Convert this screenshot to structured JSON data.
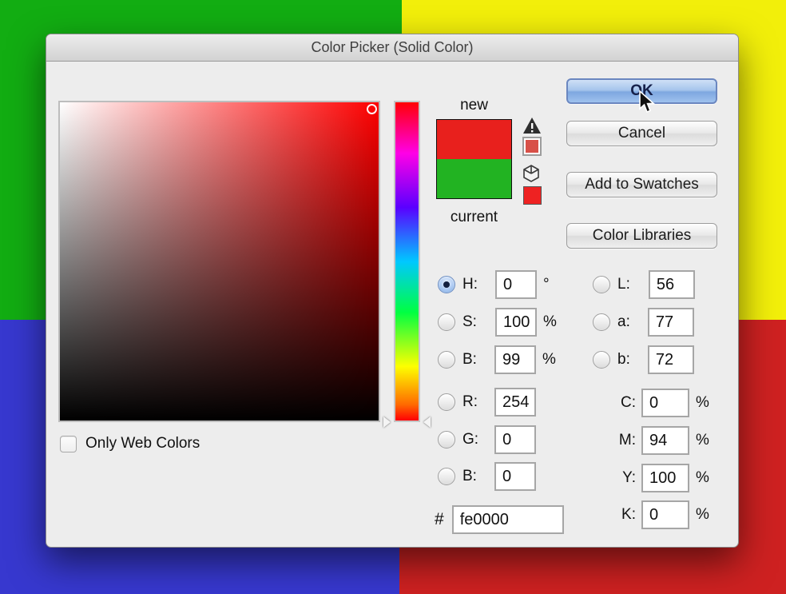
{
  "background": {
    "top_left_color": "#12ad12",
    "top_right_color": "#f2ef0a",
    "bottom_left_color": "#3738cf",
    "bottom_right_color": "#ce2121"
  },
  "dialog": {
    "title": "Color Picker (Solid Color)",
    "buttons": {
      "ok": "OK",
      "cancel": "Cancel",
      "add_to_swatches": "Add to Swatches",
      "color_libraries": "Color Libraries"
    },
    "swatch": {
      "new_label": "new",
      "current_label": "current",
      "new_color": "#e8201d",
      "current_color": "#22b322"
    },
    "checkbox": {
      "label": "Only Web Colors",
      "checked": false
    },
    "icons": {
      "gamut_warning": "out-of-gamut-warning",
      "web_warning": "not-web-safe-cube"
    },
    "fields": {
      "h": {
        "label": "H:",
        "value": "0",
        "suffix": "°"
      },
      "s": {
        "label": "S:",
        "value": "100",
        "suffix": "%"
      },
      "b": {
        "label": "B:",
        "value": "99",
        "suffix": "%"
      },
      "r": {
        "label": "R:",
        "value": "254"
      },
      "g": {
        "label": "G:",
        "value": "0"
      },
      "b2": {
        "label": "B:",
        "value": "0"
      },
      "hex": {
        "label": "#",
        "value": "fe0000"
      },
      "l": {
        "label": "L:",
        "value": "56"
      },
      "a": {
        "label": "a:",
        "value": "77"
      },
      "lab_b": {
        "label": "b:",
        "value": "72"
      },
      "c": {
        "label": "C:",
        "value": "0",
        "suffix": "%"
      },
      "m": {
        "label": "M:",
        "value": "94",
        "suffix": "%"
      },
      "y": {
        "label": "Y:",
        "value": "100",
        "suffix": "%"
      },
      "k": {
        "label": "K:",
        "value": "0",
        "suffix": "%"
      }
    }
  }
}
